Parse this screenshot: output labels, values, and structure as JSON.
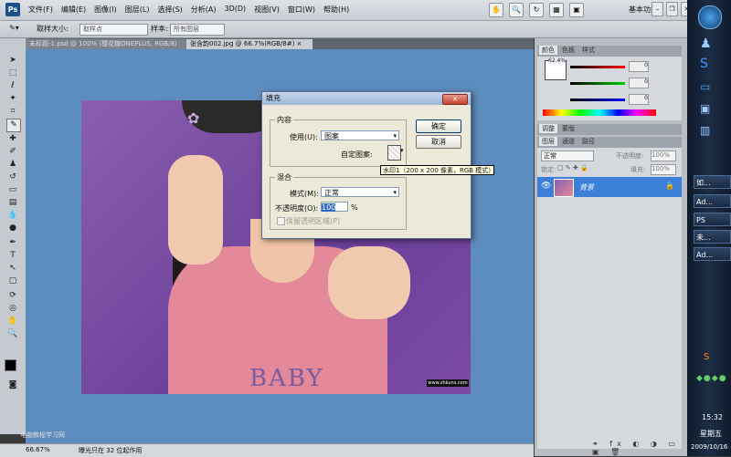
{
  "app": {
    "logo": "Ps"
  },
  "menu": [
    "文件(F)",
    "编辑(E)",
    "图像(I)",
    "图层(L)",
    "选择(S)",
    "分析(A)",
    "3D(D)",
    "视图(V)",
    "窗口(W)",
    "帮助(H)"
  ],
  "workspace_label": "基本功能",
  "options_bar": {
    "sample_size_label": "取样大小:",
    "sample_size_value": "取样点",
    "sample_label": "样本:",
    "sample_value": "所有图层"
  },
  "tabs": [
    {
      "label": "未标题-1.psd @ 100% (樱花糖ONEPLUS, RGB/8) ×",
      "active": false
    },
    {
      "label": "张含韵002.jpg @ 66.7%(RGB/8#) ×",
      "active": true
    }
  ],
  "photo": {
    "watermark_text": "BABY",
    "corner_text": "www.zhkuns.com"
  },
  "status": {
    "zoom": "66.67%",
    "message": "曝光只在 32 位起作用"
  },
  "site_watermark": "电脑教程学习网",
  "dialog": {
    "title": "填充",
    "content_group": "内容",
    "use_label": "使用(U):",
    "use_value": "图案",
    "custom_pattern_label": "自定图案:",
    "blend_group": "混合",
    "mode_label": "模式(M):",
    "mode_value": "正常",
    "opacity_label": "不透明度(O):",
    "opacity_value": "100",
    "opacity_unit": "%",
    "preserve_label": "保留透明区域(P)",
    "ok_label": "确定",
    "cancel_label": "取消",
    "tooltip": "水印1（200 x 200 像素，RGB 模式）"
  },
  "color_panel": {
    "tabs": [
      "颜色",
      "色板",
      "样式"
    ],
    "readout": "62.4%",
    "values": [
      "0",
      "0",
      "0"
    ]
  },
  "adjust_panel": {
    "tabs": [
      "调整",
      "蒙版"
    ]
  },
  "layers_panel": {
    "tabs": [
      "图层",
      "通道",
      "路径"
    ],
    "blend_mode": "正常",
    "opacity_label": "不透明度:",
    "opacity_value": "100%",
    "lock_label": "锁定:",
    "fill_label": "填充:",
    "fill_value": "100%",
    "layer_name": "背景"
  },
  "taskbar": {
    "buttons": [
      "如...",
      "Ad...",
      "PS",
      "未...",
      "Ad..."
    ],
    "time": "15:32",
    "weekday": "星期五",
    "date": "2009/10/16"
  }
}
